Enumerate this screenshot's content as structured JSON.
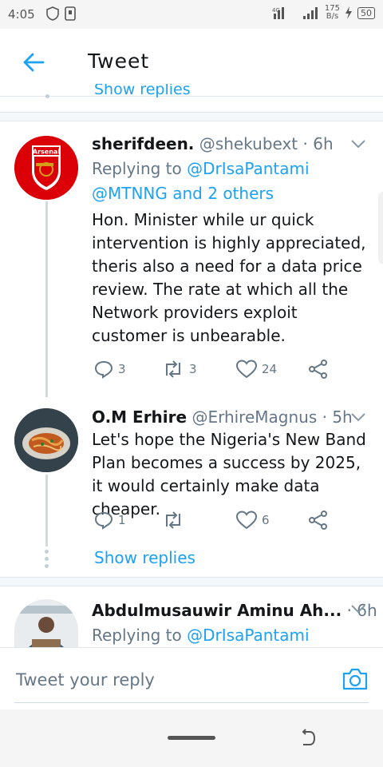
{
  "status_bar": {
    "time": "4:05",
    "net_speed_value": "175",
    "net_speed_unit": "B/s",
    "battery": "50"
  },
  "header": {
    "title": "Tweet"
  },
  "partial_show_replies": "Show replies",
  "tweets": [
    {
      "name": "sherifdeen.",
      "handle": "@shekubext",
      "time": "· 6h",
      "replying_prefix": "Replying to",
      "replying_mention1": "@DrIsaPantami",
      "replying_mention2": "@MTNNG and 2 others",
      "text": "Hon. Minister while ur quick intervention is highly appreciated, theris also a need for a data price review. The rate at which all the Network providers exploit customer is unbearable.",
      "replies": "3",
      "retweets": "3",
      "likes": "24",
      "avatar_label": "Arsenal"
    },
    {
      "name": "O.M Erhire",
      "handle": "@ErhireMagnus",
      "time": "· 5h",
      "text": "Let's hope the Nigeria's New Band Plan becomes a success by 2025, it would certainly make data cheaper.",
      "replies": "1",
      "retweets": "",
      "likes": "6",
      "show_replies": "Show replies"
    },
    {
      "name": "Abdulmusauwir Aminu Ah...",
      "time": "· 6h",
      "replying_prefix": "Replying to",
      "replying_mention1": "@DrIsaPantami"
    }
  ],
  "reply_bar": {
    "placeholder": "Tweet your reply"
  },
  "colors": {
    "accent": "#1da1f2",
    "secondary_text": "#657786"
  }
}
